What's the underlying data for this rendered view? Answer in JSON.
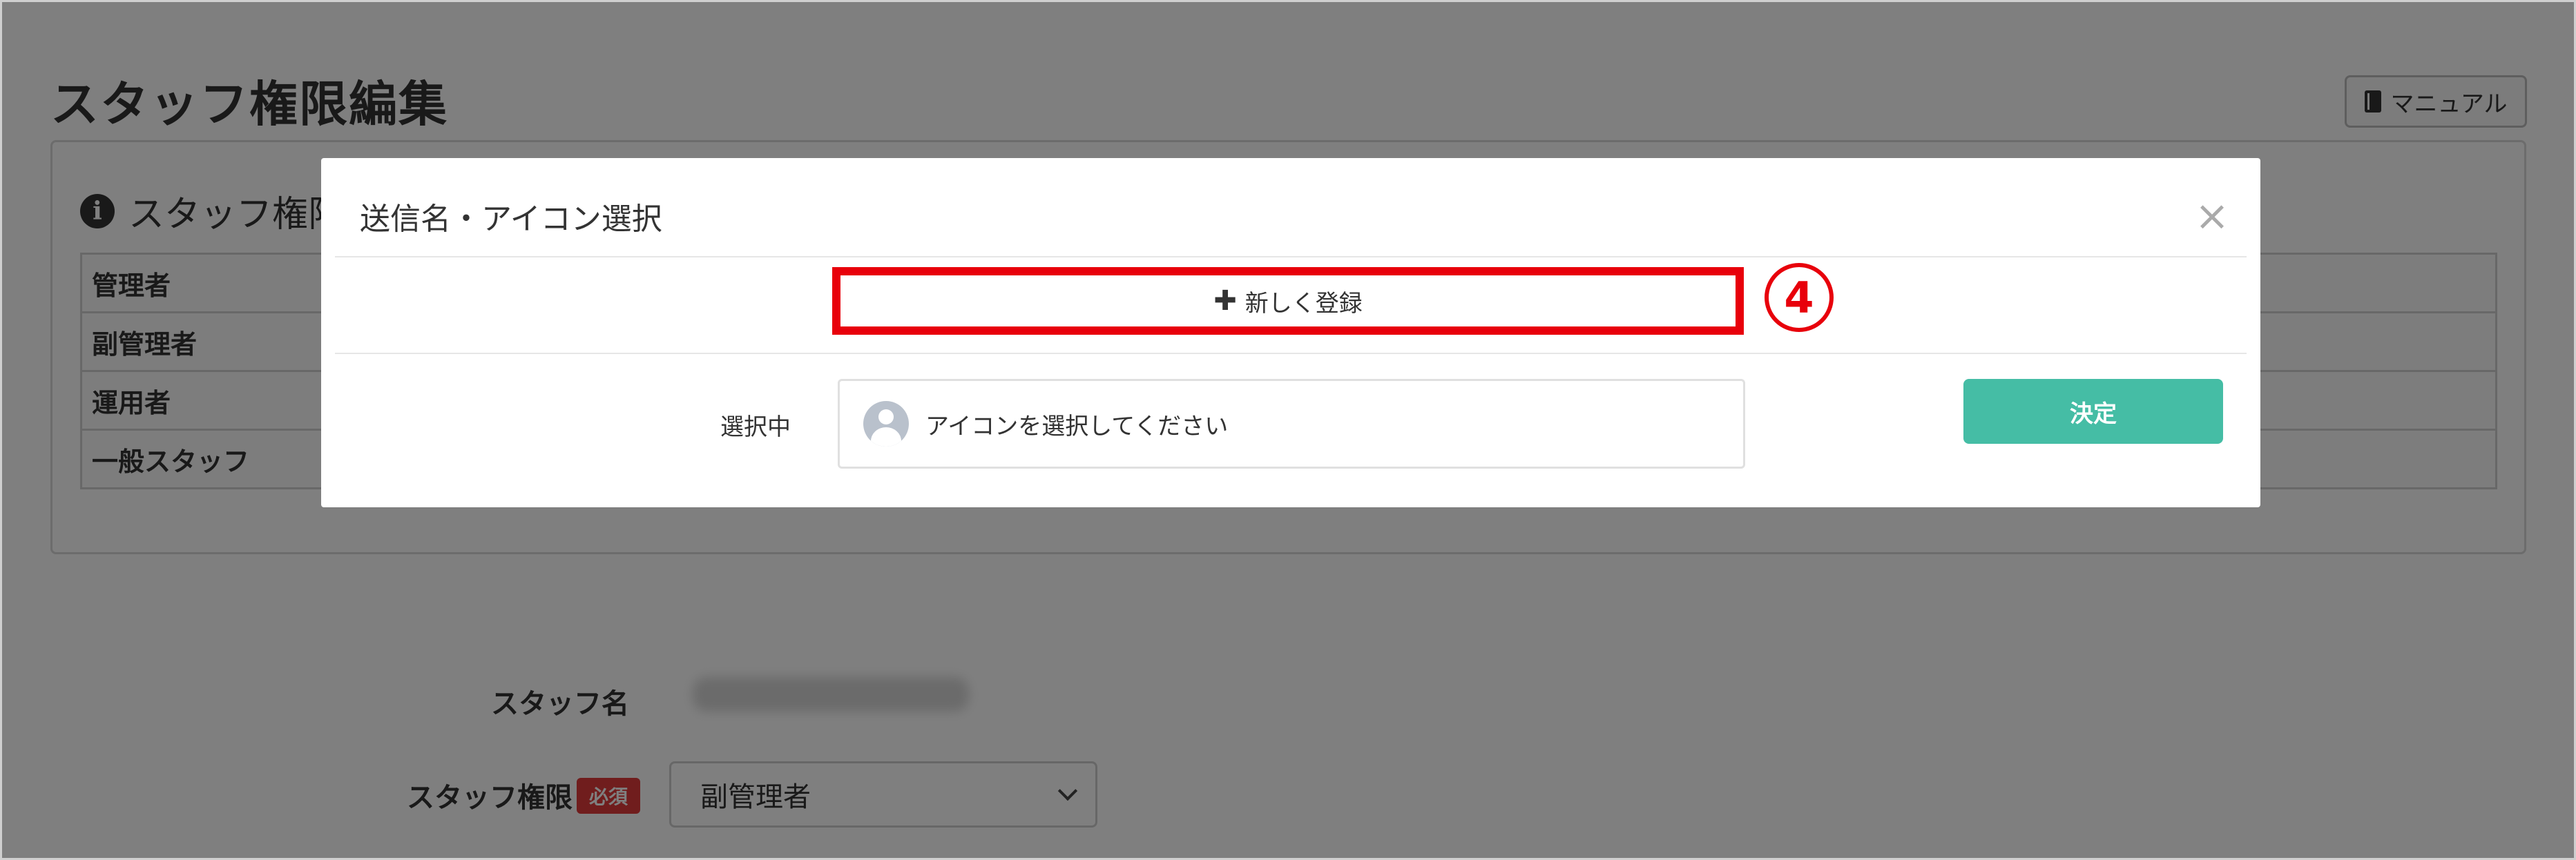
{
  "page": {
    "title": "スタッフ権限編集",
    "manual_label": "マニュアル"
  },
  "info_card": {
    "heading": "スタッフ権限",
    "roles": [
      "管理者",
      "副管理者",
      "運用者",
      "一般スタッフ"
    ]
  },
  "form": {
    "staff_name_label": "スタッフ名",
    "staff_role_label": "スタッフ権限",
    "required_badge": "必須",
    "role_value": "副管理者"
  },
  "modal": {
    "title": "送信名・アイコン選択",
    "close_symbol": "×",
    "new_register_label": "新しく登録",
    "step_marker": "4",
    "selected_label": "選択中",
    "icon_placeholder": "アイコンを選択してください",
    "confirm_label": "決定"
  },
  "colors": {
    "confirm": "#45bda5",
    "highlight": "#e8000b",
    "required": "#e03a3a"
  },
  "icons": [
    "book-icon",
    "info-icon",
    "plus-icon",
    "close-icon",
    "avatar-icon",
    "chevron-down-icon"
  ]
}
